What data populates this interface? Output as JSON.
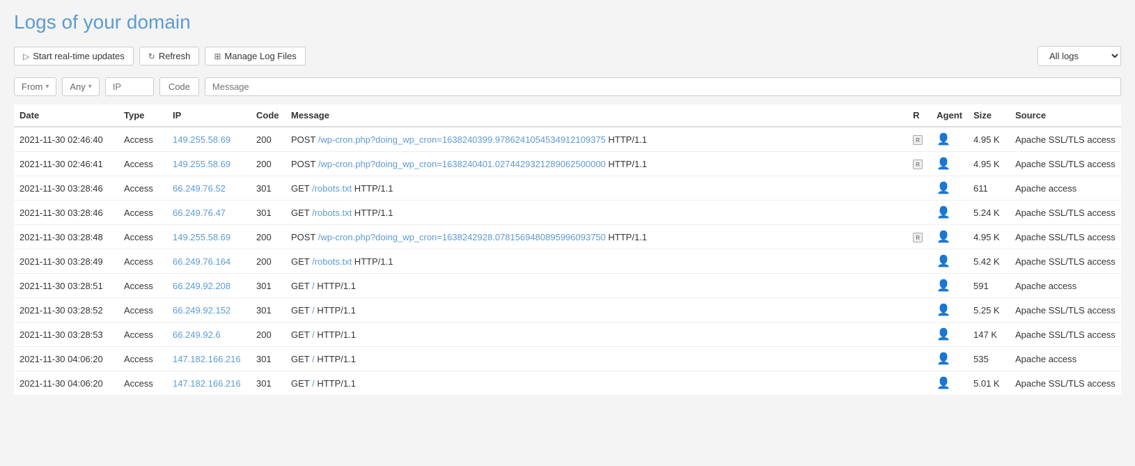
{
  "page": {
    "title_prefix": "Logs of ",
    "title_domain": "your domain"
  },
  "toolbar": {
    "start_realtime_label": "Start real-time updates",
    "refresh_label": "Refresh",
    "manage_logs_label": "Manage Log Files",
    "all_logs_label": "All logs"
  },
  "filters": {
    "from_label": "From",
    "any_label": "Any",
    "ip_placeholder": "IP",
    "code_label": "Code",
    "message_placeholder": "Message"
  },
  "table": {
    "columns": [
      "Date",
      "Type",
      "IP",
      "Code",
      "Message",
      "R",
      "Agent",
      "Size",
      "Source"
    ],
    "rows": [
      {
        "date": "2021-11-30 02:46:40",
        "type": "Access",
        "ip": "149.255.58.69",
        "code": "200",
        "message_prefix": "POST ",
        "message_link": "/wp-cron.php?doing_wp_cron=1638240399.9786241054534912109375",
        "message_suffix": " HTTP/1.1",
        "has_robot": true,
        "agent_type": "human",
        "size": "4.95 K",
        "source": "Apache SSL/TLS access"
      },
      {
        "date": "2021-11-30 02:46:41",
        "type": "Access",
        "ip": "149.255.58.69",
        "code": "200",
        "message_prefix": "POST ",
        "message_link": "/wp-cron.php?doing_wp_cron=1638240401.0274429321289062500000",
        "message_suffix": " HTTP/1.1",
        "has_robot": true,
        "agent_type": "human",
        "size": "4.95 K",
        "source": "Apache SSL/TLS access"
      },
      {
        "date": "2021-11-30 03:28:46",
        "type": "Access",
        "ip": "66.249.76.52",
        "code": "301",
        "message_prefix": "GET ",
        "message_link": "/robots.txt",
        "message_suffix": " HTTP/1.1",
        "has_robot": false,
        "agent_type": "bot",
        "size": "611",
        "source": "Apache access"
      },
      {
        "date": "2021-11-30 03:28:46",
        "type": "Access",
        "ip": "66.249.76.47",
        "code": "301",
        "message_prefix": "GET ",
        "message_link": "/robots.txt",
        "message_suffix": " HTTP/1.1",
        "has_robot": false,
        "agent_type": "bot",
        "size": "5.24 K",
        "source": "Apache SSL/TLS access"
      },
      {
        "date": "2021-11-30 03:28:48",
        "type": "Access",
        "ip": "149.255.58.69",
        "code": "200",
        "message_prefix": "POST ",
        "message_link": "/wp-cron.php?doing_wp_cron=1638242928.0781569480895996093750",
        "message_suffix": " HTTP/1.1",
        "has_robot": true,
        "agent_type": "human",
        "size": "4.95 K",
        "source": "Apache SSL/TLS access"
      },
      {
        "date": "2021-11-30 03:28:49",
        "type": "Access",
        "ip": "66.249.76.164",
        "code": "200",
        "message_prefix": "GET ",
        "message_link": "/robots.txt",
        "message_suffix": " HTTP/1.1",
        "has_robot": false,
        "agent_type": "bot",
        "size": "5.42 K",
        "source": "Apache SSL/TLS access"
      },
      {
        "date": "2021-11-30 03:28:51",
        "type": "Access",
        "ip": "66.249.92.208",
        "code": "301",
        "message_prefix": "GET ",
        "message_link": "/",
        "message_suffix": " HTTP/1.1",
        "has_robot": false,
        "agent_type": "bot",
        "size": "591",
        "source": "Apache access"
      },
      {
        "date": "2021-11-30 03:28:52",
        "type": "Access",
        "ip": "66.249.92.152",
        "code": "301",
        "message_prefix": "GET ",
        "message_link": "/",
        "message_suffix": " HTTP/1.1",
        "has_robot": false,
        "agent_type": "bot",
        "size": "5.25 K",
        "source": "Apache SSL/TLS access"
      },
      {
        "date": "2021-11-30 03:28:53",
        "type": "Access",
        "ip": "66.249.92.6",
        "code": "200",
        "message_prefix": "GET ",
        "message_link": "/",
        "message_suffix": " HTTP/1.1",
        "has_robot": false,
        "agent_type": "bot",
        "size": "147 K",
        "source": "Apache SSL/TLS access"
      },
      {
        "date": "2021-11-30 04:06:20",
        "type": "Access",
        "ip": "147.182.166.216",
        "code": "301",
        "message_prefix": "GET ",
        "message_link": "/",
        "message_suffix": " HTTP/1.1",
        "has_robot": false,
        "agent_type": "bot2",
        "size": "535",
        "source": "Apache access"
      },
      {
        "date": "2021-11-30 04:06:20",
        "type": "Access",
        "ip": "147.182.166.216",
        "code": "301",
        "message_prefix": "GET ",
        "message_link": "/",
        "message_suffix": " HTTP/1.1",
        "has_robot": false,
        "agent_type": "bot2",
        "size": "5.01 K",
        "source": "Apache SSL/TLS access"
      }
    ]
  }
}
